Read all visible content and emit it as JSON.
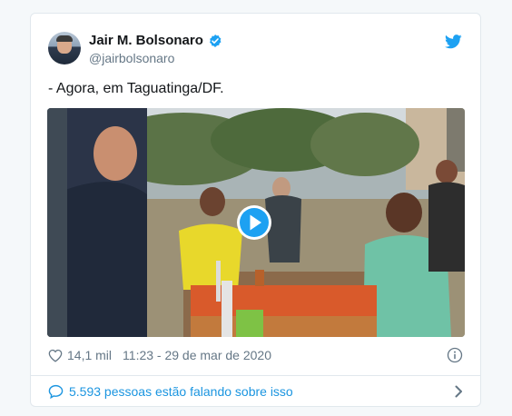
{
  "tweet": {
    "author": {
      "name": "Jair M. Bolsonaro",
      "handle": "@jairbolsonaro",
      "verified": true
    },
    "text": "- Agora, em Taguatinga/DF.",
    "media": {
      "type": "video",
      "icon": "play-icon"
    },
    "likes": "14,1 mil",
    "timestamp": "11:23 - 29 de mar de 2020",
    "conversation": "5.593 pessoas estão falando sobre isso"
  },
  "colors": {
    "accent": "#1da1f2",
    "link": "#1b95e0",
    "muted": "#657786",
    "border": "#e1e8ed"
  },
  "icons": [
    "verified-icon",
    "twitter-bird-icon",
    "play-icon",
    "heart-icon",
    "info-icon",
    "speech-bubble-icon",
    "chevron-right-icon"
  ]
}
